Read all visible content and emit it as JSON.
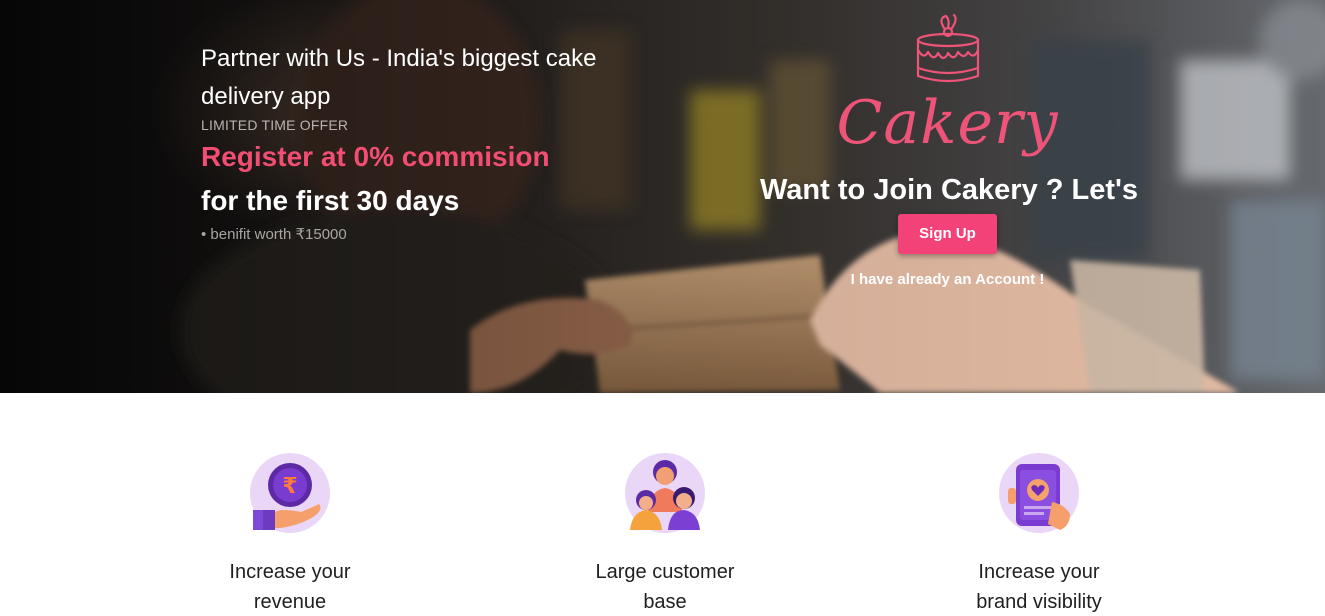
{
  "hero": {
    "headline": "Partner with Us - India's biggest cake delivery app",
    "offer_tag": "LIMITED TIME OFFER",
    "offer_line": "Register at 0% commision",
    "offer_sub": "for the first 30 days",
    "benefit": "• benifit worth ₹15000"
  },
  "brand": {
    "name": "Cakery",
    "logo_icon": "cake-icon",
    "accent_color": "#f34277"
  },
  "join": {
    "prompt": "Want to Join Cakery ? Let's",
    "signup_label": "Sign Up",
    "login_label": "I have already an Account !"
  },
  "features": [
    {
      "icon": "rupee-coin-hand-icon",
      "title": "Increase your revenue"
    },
    {
      "icon": "customers-icon",
      "title": "Large customer base"
    },
    {
      "icon": "phone-heart-icon",
      "title": "Increase your brand visibility"
    }
  ]
}
